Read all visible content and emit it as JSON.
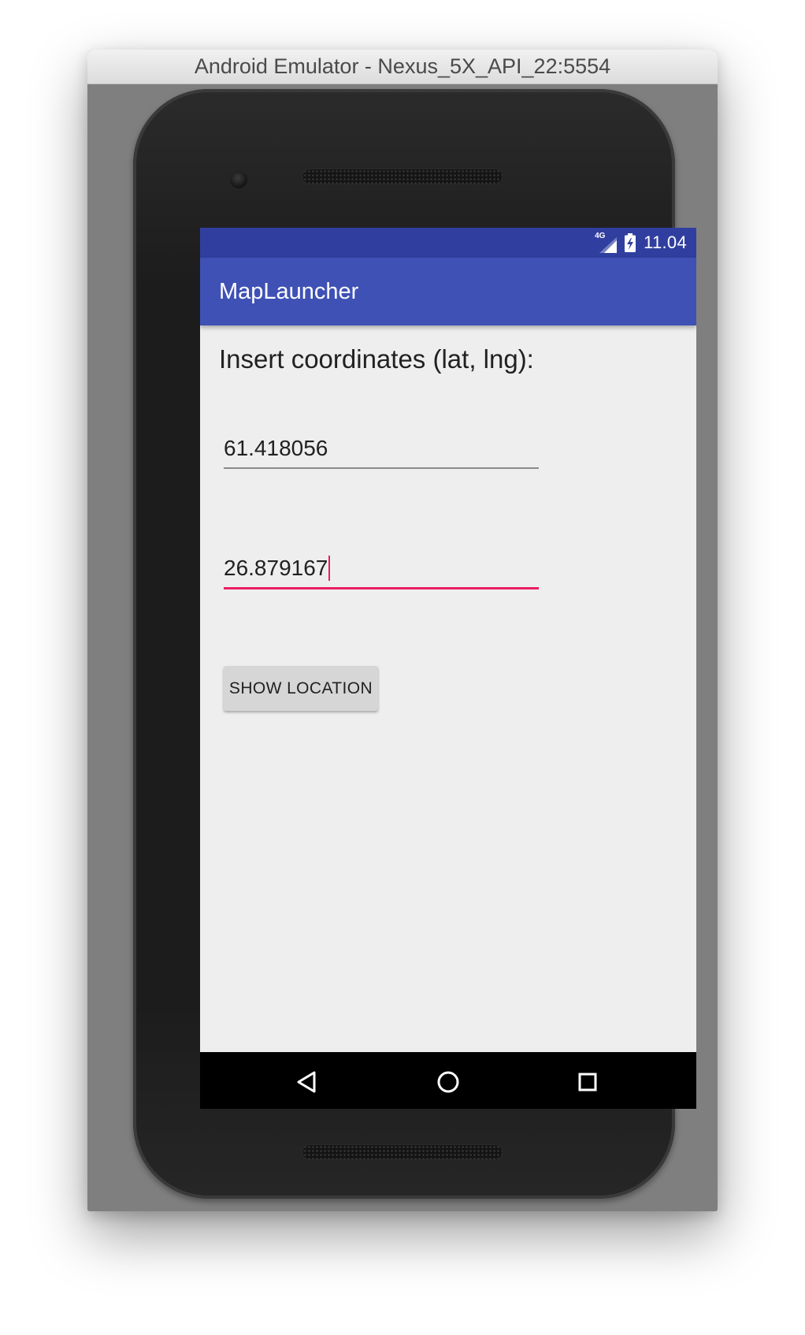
{
  "window": {
    "title": "Android Emulator - Nexus_5X_API_22:5554"
  },
  "status_bar": {
    "network_label": "4G",
    "network_icon": "signal-icon",
    "battery_icon": "battery-charging-icon",
    "time": "11.04",
    "color": "#303f9f"
  },
  "app_bar": {
    "title": "MapLauncher",
    "color": "#3f51b5"
  },
  "form": {
    "prompt": "Insert coordinates (lat, lng):",
    "latitude_value": "61.418056",
    "longitude_value": "26.879167",
    "accent_color": "#e91e63",
    "button_label": "SHOW LOCATION"
  },
  "nav_bar": {
    "back_icon": "back-triangle-icon",
    "home_icon": "home-circle-icon",
    "recents_icon": "recents-square-icon"
  }
}
